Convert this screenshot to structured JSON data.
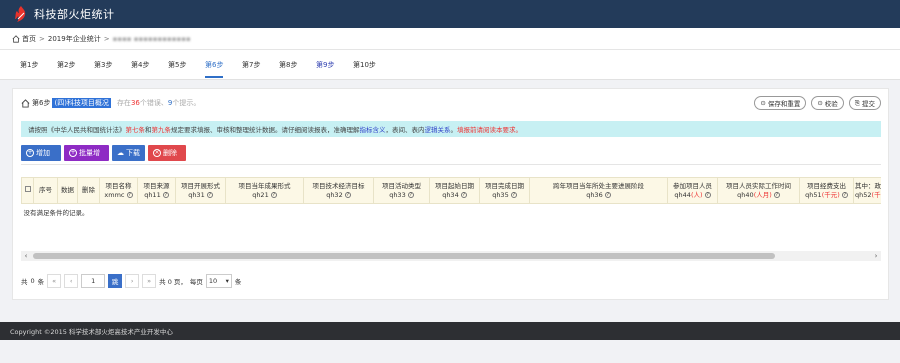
{
  "header": {
    "app_title": "科技部火炬统计"
  },
  "breadcrumb": {
    "home": "首页",
    "sep": ">",
    "current": "2019年企业统计"
  },
  "steps": [
    "第1步",
    "第2步",
    "第3步",
    "第4步",
    "第5步",
    "第6步",
    "第7步",
    "第8步",
    "第9步",
    "第10步"
  ],
  "active_step": "第6步",
  "panel": {
    "step_prefix": "第6步",
    "section_title": "(四)科技项目概况",
    "meta_pre": "存在",
    "error_count": "36",
    "meta_mid": "个错误、",
    "warn_count": "9",
    "meta_post": "个提示。",
    "buttons": {
      "save_prev": "保存和重置",
      "check": "校验",
      "submit": "提交"
    }
  },
  "notice": {
    "t1": "请按照《中华人民共和国统计法》",
    "r1": "第七条",
    "t2": "和",
    "r2": "第九条",
    "t3": "规定要求填报、审核和整理统计数据。请仔细阅读报表，准确理解",
    "b1": "指标含义",
    "t4": "，表间、表内",
    "b2": "逻辑关系",
    "t5": "。",
    "r3": "填报前请阅读本要求。"
  },
  "toolbar": {
    "add": "增加",
    "batch": "批量增",
    "download": "下载",
    "delete": "删除"
  },
  "table": {
    "headers": [
      {
        "l1": "序号",
        "l2": ""
      },
      {
        "l1": "数据",
        "l2": ""
      },
      {
        "l1": "删除",
        "l2": ""
      },
      {
        "l1": "项目名称",
        "l2": "xmmc"
      },
      {
        "l1": "项目来源",
        "l2": "qh11"
      },
      {
        "l1": "项目开展形式",
        "l2": "qh31"
      },
      {
        "l1": "项目当年成果形式",
        "l2": "qh21"
      },
      {
        "l1": "项目技术经济目标",
        "l2": "qh32"
      },
      {
        "l1": "项目活动类型",
        "l2": "qh33"
      },
      {
        "l1": "项目起始日期",
        "l2": "qh34"
      },
      {
        "l1": "项目完成日期",
        "l2": "qh35"
      },
      {
        "l1": "跨年项目当年所处主要进展阶段",
        "l2": "qh36"
      },
      {
        "l1": "参加项目人员",
        "l2": "qh44",
        "unit": "(人)"
      },
      {
        "l1": "项目人员实际工作时间",
        "l2": "qh40",
        "unit": "(人月)"
      },
      {
        "l1": "项目经费支出",
        "l2": "qh51",
        "unit": "(千元)"
      },
      {
        "l1": "其中：政府",
        "l2": "qh52",
        "unit": "(千元)"
      }
    ],
    "empty_text": "没有满足条件的记录。"
  },
  "pager": {
    "total_pre": "共",
    "total_count": "0",
    "total_post": "条",
    "first": "«",
    "prev": "‹",
    "page_value": "1",
    "go": "跳",
    "next": "›",
    "last": "»",
    "pages_text": "共 0 页，",
    "per_page_label": "每页",
    "per_page_value": "10",
    "per_page_unit": "条"
  },
  "footer": {
    "copyright": "Copyright ©2015 科学技术部火炬高技术产业开发中心"
  }
}
